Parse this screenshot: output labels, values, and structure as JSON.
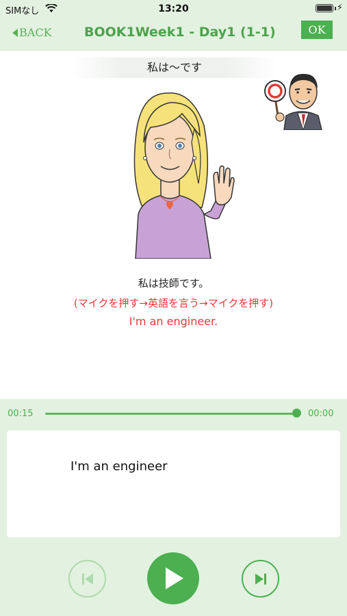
{
  "status_bar": {
    "carrier": "SIMなし",
    "time": "13:20"
  },
  "nav": {
    "back_label": "BACK",
    "title": "BOOK1Week1 - Day1 (1-1)",
    "ok_label": "OK"
  },
  "lesson": {
    "phrase_pattern": "私は～です",
    "sentence_jp": "私は技師です。",
    "instruction": "(マイクを押す→英語を言う→マイクを押す)",
    "sentence_en": "I'm an engineer."
  },
  "player": {
    "time_elapsed": "00:15",
    "time_remaining": "00:00",
    "progress": 1.0,
    "answer_text": "I'm an engineer"
  },
  "colors": {
    "accent_green": "#4caf50",
    "highlight_red": "#e53935",
    "panel_bg": "#e3f1e0"
  },
  "icons": {
    "prev": "skip-previous-icon",
    "play": "play-icon",
    "next": "skip-next-icon",
    "wifi": "wifi-icon",
    "battery": "battery-icon"
  }
}
